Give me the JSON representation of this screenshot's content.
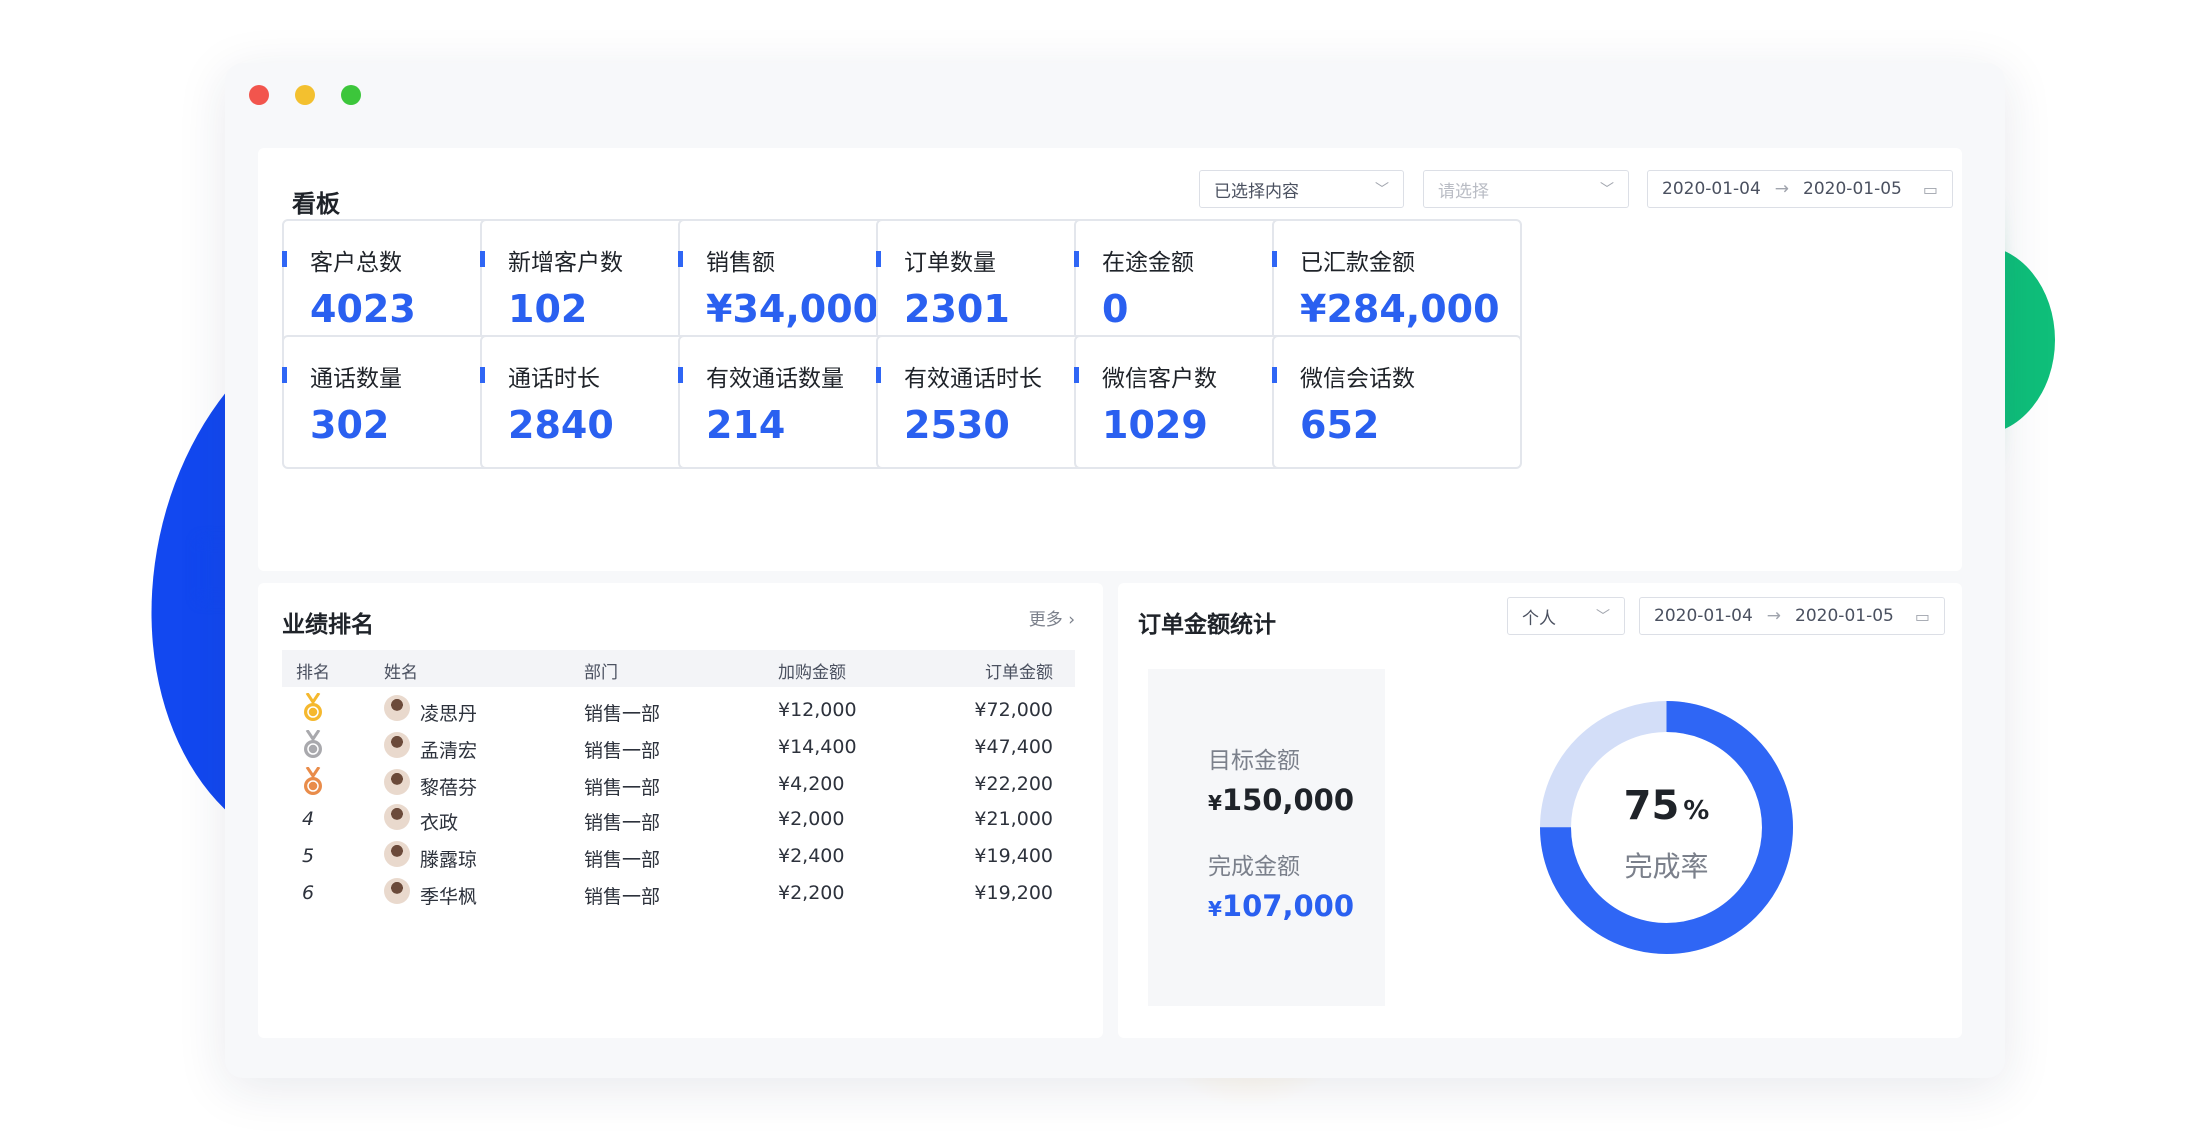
{
  "board": {
    "title": "看板",
    "filter_select": "已选择内容",
    "placeholder_select": "请选择",
    "date_start": "2020-01-04",
    "date_end": "2020-01-05",
    "metrics": [
      {
        "label": "客户总数",
        "value": "4023"
      },
      {
        "label": "新增客户数",
        "value": "102"
      },
      {
        "label": "销售额",
        "value": "¥34,000"
      },
      {
        "label": "订单数量",
        "value": "2301"
      },
      {
        "label": "在途金额",
        "value": "0"
      },
      {
        "label": "已汇款金额",
        "value": "¥284,000"
      },
      {
        "label": "通话数量",
        "value": "302"
      },
      {
        "label": "通话时长",
        "value": "2840"
      },
      {
        "label": "有效通话数量",
        "value": "214"
      },
      {
        "label": "有效通话时长",
        "value": "2530"
      },
      {
        "label": "微信客户数",
        "value": "1029"
      },
      {
        "label": "微信会话数",
        "value": "652"
      }
    ]
  },
  "ranking": {
    "title": "业绩排名",
    "more": "更多",
    "columns": [
      "排名",
      "姓名",
      "部门",
      "加购金额",
      "订单金额"
    ],
    "rows": [
      {
        "rank": "1",
        "name": "凌思丹",
        "dept": "销售一部",
        "cart": "¥12,000",
        "order": "¥72,000"
      },
      {
        "rank": "2",
        "name": "孟清宏",
        "dept": "销售一部",
        "cart": "¥14,400",
        "order": "¥47,400"
      },
      {
        "rank": "3",
        "name": "黎蓓芬",
        "dept": "销售一部",
        "cart": "¥4,200",
        "order": "¥22,200"
      },
      {
        "rank": "4",
        "name": "衣政",
        "dept": "销售一部",
        "cart": "¥2,000",
        "order": "¥21,000"
      },
      {
        "rank": "5",
        "name": "滕露琼",
        "dept": "销售一部",
        "cart": "¥2,400",
        "order": "¥19,400"
      },
      {
        "rank": "6",
        "name": "季华枫",
        "dept": "销售一部",
        "cart": "¥2,200",
        "order": "¥19,200"
      }
    ],
    "medal_colors": [
      "#f5b82e",
      "#a9a9ad",
      "#e98c4a"
    ]
  },
  "order_stats": {
    "title": "订单金额统计",
    "scope_select": "个人",
    "date_start": "2020-01-04",
    "date_end": "2020-01-05",
    "target_label": "目标金额",
    "target_currency": "¥",
    "target_value": "150,000",
    "done_label": "完成金额",
    "done_currency": "¥",
    "done_value": "107,000",
    "completion_percent": 75,
    "completion_number": "75",
    "percent_sign": "%",
    "completion_label": "完成率",
    "ring_color": "#2f66f5",
    "ring_track_color": "#d3def8"
  }
}
